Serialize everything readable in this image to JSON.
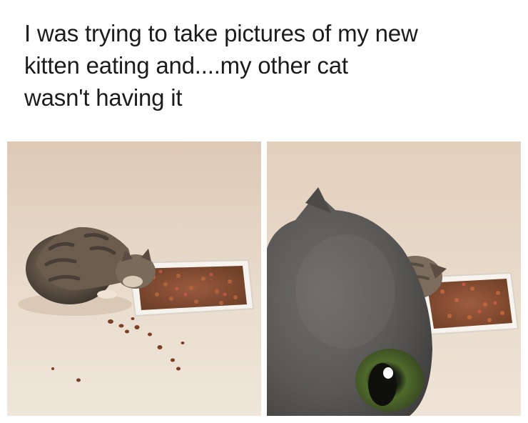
{
  "caption": {
    "line1": "I was trying to take pictures of my new",
    "line2": "kitten eating and....my other cat",
    "line3": "wasn't having it"
  },
  "photos": [
    {
      "subject": "kitten-eating-from-food-tray"
    },
    {
      "subject": "gray-cat-photobombing-close-up"
    }
  ]
}
